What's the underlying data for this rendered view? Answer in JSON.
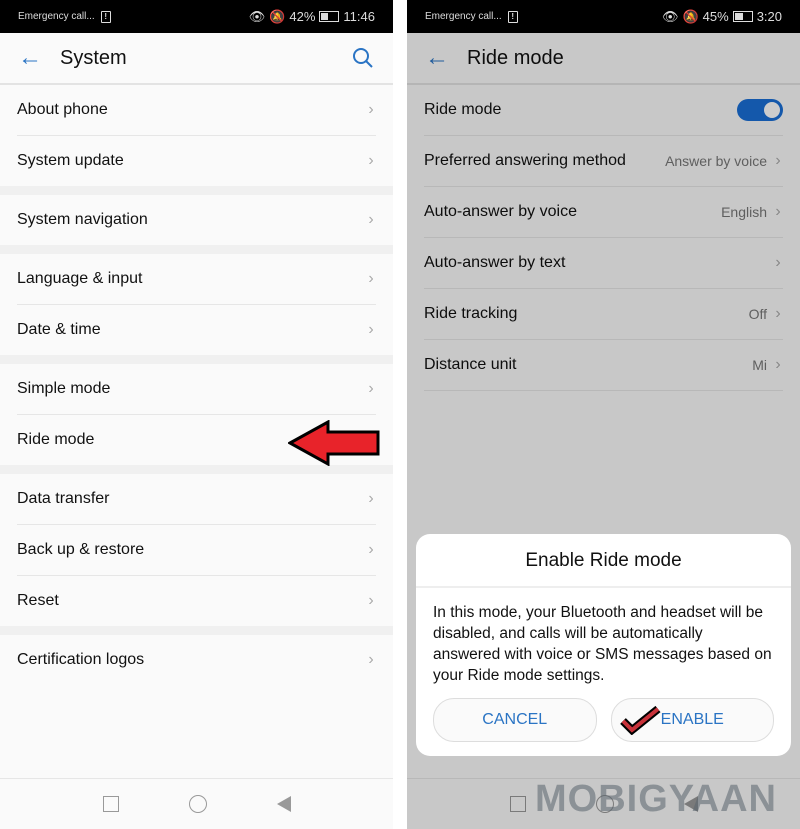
{
  "left": {
    "status": {
      "carrier": "Emergency call...",
      "battery": "42%",
      "battery_level": 0.42,
      "time": "11:46"
    },
    "title": "System",
    "groups": [
      [
        {
          "label": "About phone"
        },
        {
          "label": "System update"
        }
      ],
      [
        {
          "label": "System navigation"
        }
      ],
      [
        {
          "label": "Language & input"
        },
        {
          "label": "Date & time"
        }
      ],
      [
        {
          "label": "Simple mode"
        },
        {
          "label": "Ride mode"
        }
      ],
      [
        {
          "label": "Data transfer"
        },
        {
          "label": "Back up & restore"
        },
        {
          "label": "Reset"
        }
      ],
      [
        {
          "label": "Certification logos"
        }
      ]
    ]
  },
  "right": {
    "status": {
      "carrier": "Emergency call...",
      "battery": "45%",
      "battery_state": "charging",
      "time": "3:20"
    },
    "title": "Ride mode",
    "rows": [
      {
        "label": "Ride mode",
        "toggle": true
      },
      {
        "label": "Preferred answering method",
        "value": "Answer by voice"
      },
      {
        "label": "Auto-answer by voice",
        "value": "English"
      },
      {
        "label": "Auto-answer by text",
        "value": ""
      },
      {
        "label": "Ride tracking",
        "value": "Off"
      },
      {
        "label": "Distance unit",
        "value": "Mi"
      }
    ],
    "dialog": {
      "title": "Enable Ride mode",
      "body": "In this mode, your Bluetooth and headset will be disabled, and calls will be automatically answered with voice or SMS messages based on your Ride mode settings.",
      "cancel": "CANCEL",
      "enable": "ENABLE"
    }
  },
  "watermark": "MOBIGYAAN",
  "colors": {
    "accent": "#2a74c4",
    "toggle": "#1a6fd6",
    "annotation": "#e8232a"
  }
}
